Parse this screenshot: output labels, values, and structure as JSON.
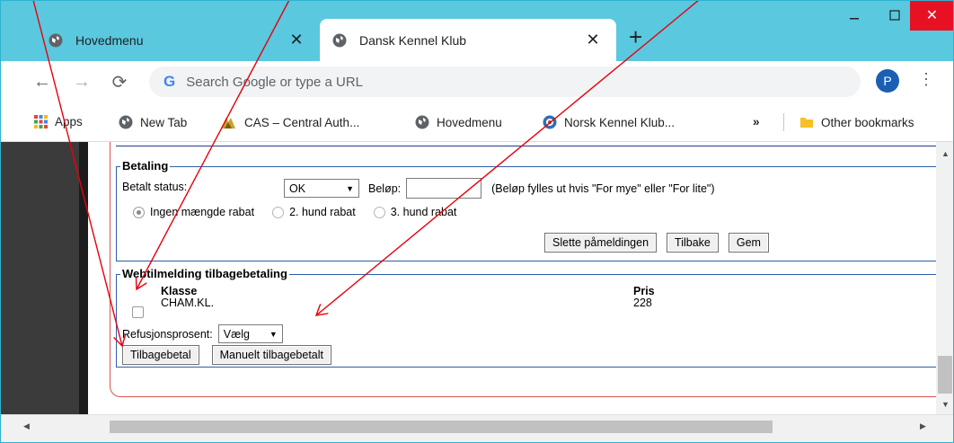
{
  "browser": {
    "tabs": [
      {
        "title": "Hovedmenu",
        "active": false
      },
      {
        "title": "Dansk Kennel Klub",
        "active": true
      }
    ],
    "omnibox_placeholder": "Search Google or type a URL",
    "profile_initial": "P",
    "bookmarks": [
      {
        "label": "Apps",
        "icon": "apps-grid-icon"
      },
      {
        "label": "New Tab",
        "icon": "globe-icon"
      },
      {
        "label": "CAS – Central Auth...",
        "icon": "cas-logo-icon"
      },
      {
        "label": "Hovedmenu",
        "icon": "globe-icon"
      },
      {
        "label": "Norsk Kennel Klub...",
        "icon": "nkk-logo-icon"
      }
    ],
    "bookmarks_overflow": "»",
    "other_bookmarks": "Other bookmarks"
  },
  "betaling": {
    "legend": "Betaling",
    "status_label": "Betalt status:",
    "status_value": "OK",
    "amount_label": "Beløp:",
    "amount_value": "",
    "amount_hint": "(Beløp fylles ut hvis \"For mye\" eller \"For lite\")",
    "radios": [
      {
        "label": "Ingen mængde rabat",
        "checked": true
      },
      {
        "label": "2. hund rabat",
        "checked": false
      },
      {
        "label": "3. hund rabat",
        "checked": false
      }
    ],
    "buttons": {
      "delete": "Slette påmeldingen",
      "back": "Tilbake",
      "save": "Gem"
    }
  },
  "refund": {
    "legend": "Webtilmelding tilbagebetaling",
    "col_class": "Klasse",
    "col_price": "Pris",
    "rows": [
      {
        "klasse": "CHAM.KL.",
        "pris": "228",
        "checked": false
      }
    ],
    "percent_label": "Refusjonsprosent:",
    "percent_value": "Vælg",
    "buttons": {
      "refund": "Tilbagebetal",
      "manual": "Manuelt tilbagebetalt"
    }
  },
  "colors": {
    "titlebar": "#5ac8de",
    "close_button": "#e81123",
    "fieldset_border": "#2e5ea6",
    "frame_border": "#d9534f",
    "annotation_arrows": "#e8000b"
  }
}
